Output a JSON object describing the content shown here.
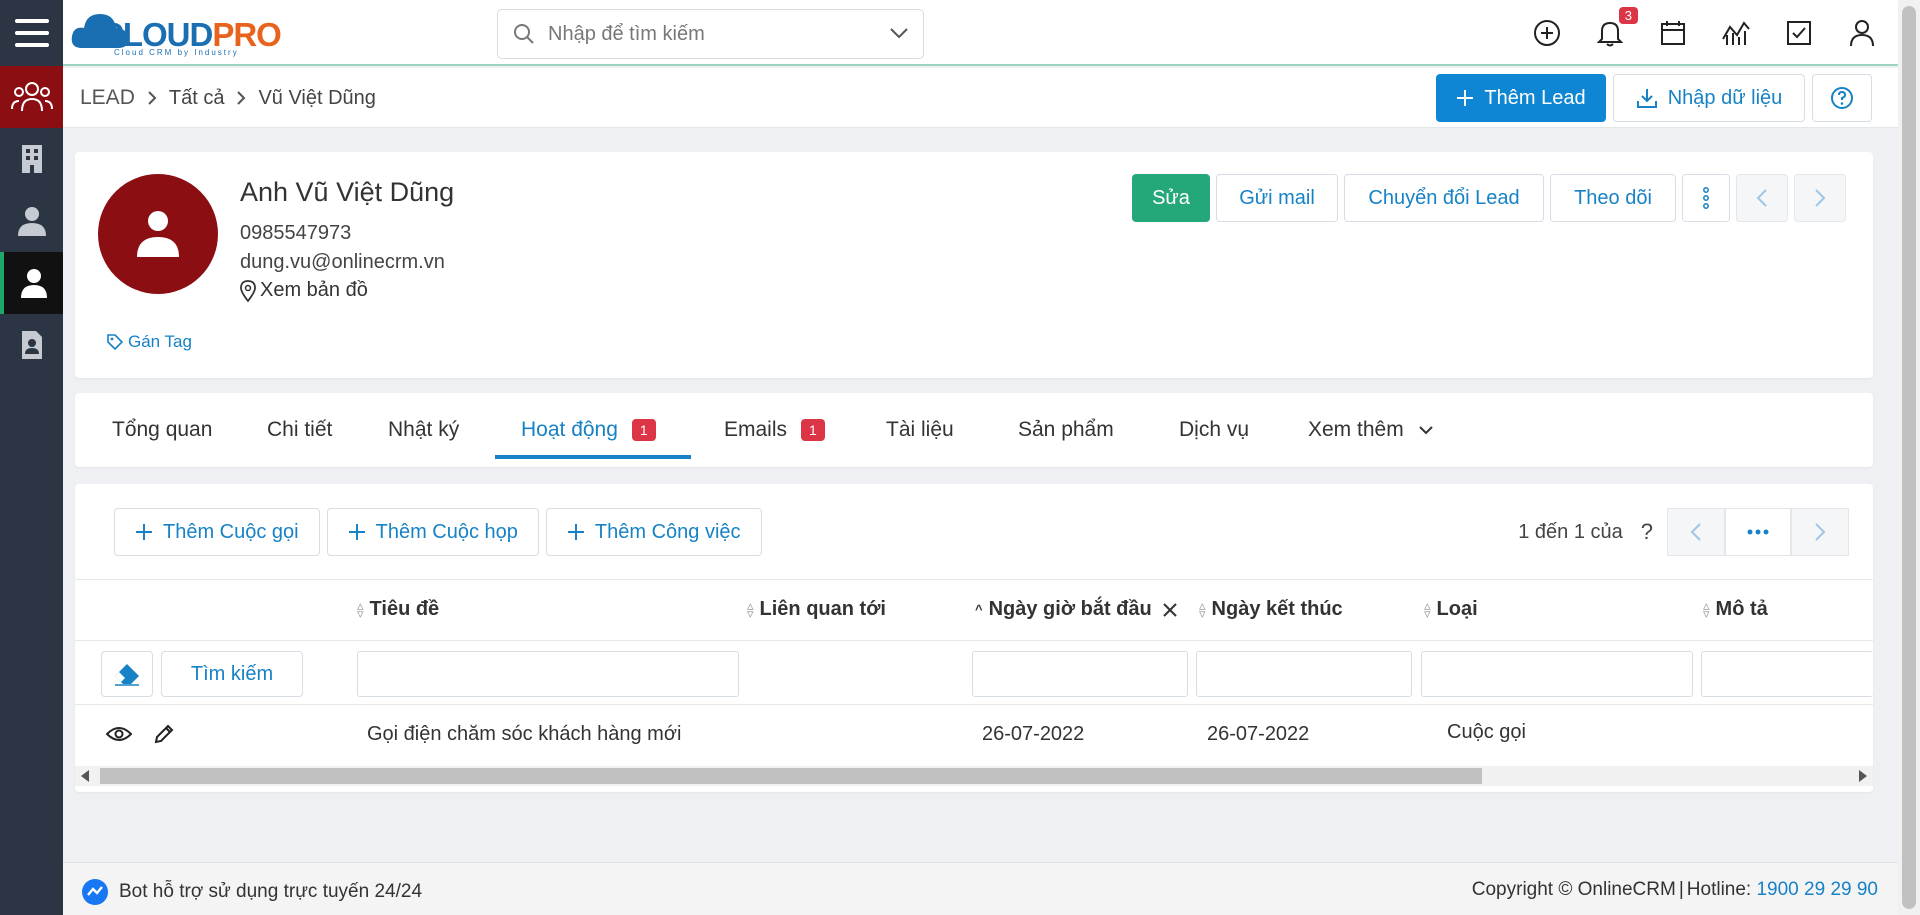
{
  "topbar": {
    "logo_text_1": "CLOUD",
    "logo_text_2": "PRO",
    "logo_tagline": "Cloud CRM by Industry",
    "search_placeholder": "Nhập để tìm kiếm",
    "notification_count": "3"
  },
  "breadcrumb": {
    "root": "LEAD",
    "level1": "Tất cả",
    "current": "Vũ Việt Dũng"
  },
  "header_actions": {
    "add_lead": "Thêm Lead",
    "import_data": "Nhập dữ liệu"
  },
  "profile": {
    "name": "Anh Vũ Việt Dũng",
    "phone": "0985547973",
    "email": "dung.vu@onlinecrm.vn",
    "map_link": "Xem bản đồ",
    "tag_link": "Gán Tag",
    "actions": {
      "edit": "Sửa",
      "send_mail": "Gửi mail",
      "convert": "Chuyển đổi Lead",
      "follow": "Theo dõi"
    }
  },
  "tabs": [
    {
      "label": "Tổng quan"
    },
    {
      "label": "Chi tiết"
    },
    {
      "label": "Nhật ký"
    },
    {
      "label": "Hoạt động",
      "badge": "1"
    },
    {
      "label": "Emails",
      "badge": "1"
    },
    {
      "label": "Tài liệu"
    },
    {
      "label": "Sản phẩm"
    },
    {
      "label": "Dịch vụ"
    },
    {
      "label": "Xem thêm"
    }
  ],
  "activity": {
    "add_call": "Thêm Cuộc gọi",
    "add_meeting": "Thêm Cuộc họp",
    "add_task": "Thêm Công việc",
    "pager_info": "1 đến 1 của",
    "pager_help": "?",
    "search_button": "Tìm kiếm",
    "columns": [
      "Tiêu đề",
      "Liên quan tới",
      "Ngày giờ bắt đầu",
      "Ngày kết thúc",
      "Loại",
      "Mô tả"
    ],
    "rows": [
      {
        "title": "Gọi điện chăm sóc khách hàng mới",
        "related": "",
        "start": "26-07-2022",
        "end": "26-07-2022",
        "type": "Cuộc gọi",
        "desc": ""
      }
    ]
  },
  "footer": {
    "bot_text": "Bot hỗ trợ sử dụng trực tuyến 24/24",
    "copyright": "Copyright © OnlineCRM",
    "hotline_label": "Hotline:",
    "hotline": "1900 29 29 90"
  },
  "colors": {
    "sidebar": "#2c3544",
    "primary": "#0e86d4",
    "success": "#24a87a",
    "badge": "#dc3545",
    "avatar": "#8b0e12"
  }
}
